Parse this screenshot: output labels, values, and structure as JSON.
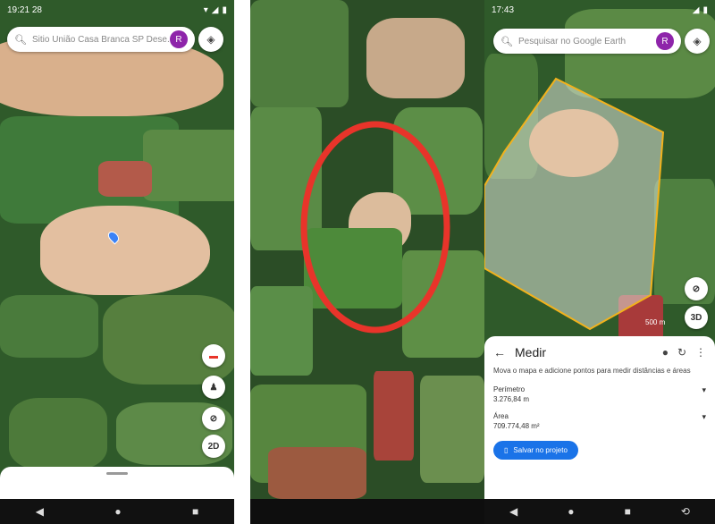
{
  "panel1": {
    "status": {
      "time": "19:21",
      "extra": "28"
    },
    "search": {
      "text": "Sitio União Casa Branca SP Dese...",
      "avatar": "R"
    },
    "fab_2d": "2D"
  },
  "panel3": {
    "status": {
      "time": "17:43"
    },
    "search": {
      "placeholder": "Pesquisar no Google Earth",
      "avatar": "R"
    },
    "scale": "500 m",
    "fab_3d": "3D",
    "measure": {
      "title": "Medir",
      "hint": "Mova o mapa e adicione pontos para medir distâncias e áreas",
      "perimeter_label": "Perímetro",
      "perimeter_value": "3.276,84 m",
      "area_label": "Área",
      "area_value": "709.774,48 m²",
      "save_label": "Salvar no projeto"
    }
  },
  "colors": {
    "annotation": "#e8342a",
    "polygon": "#f2b21c",
    "brand": "#1a73e8",
    "avatar": "#8e24aa"
  },
  "icons": [
    "search-icon",
    "layers-icon",
    "pin-icon",
    "pegman-icon",
    "compass-icon",
    "back-icon",
    "undo-icon",
    "more-icon"
  ]
}
